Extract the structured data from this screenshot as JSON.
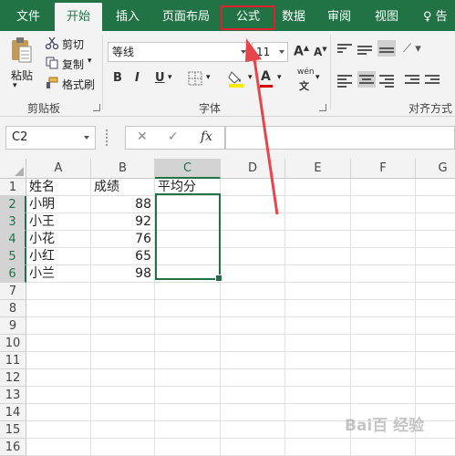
{
  "ribbon_tabs": [
    {
      "label": "文件"
    },
    {
      "label": "开始"
    },
    {
      "label": "插入"
    },
    {
      "label": "页面布局"
    },
    {
      "label": "公式"
    },
    {
      "label": "数据"
    },
    {
      "label": "审阅"
    },
    {
      "label": "视图"
    }
  ],
  "help_label": "♀ 告",
  "clipboard": {
    "paste_label": "粘贴",
    "cut_label": "剪切",
    "copy_label": "复制",
    "format_painter_label": "格式刷",
    "group_label": "剪贴板"
  },
  "font": {
    "name_value": "等线",
    "size_value": "11",
    "grow_label": "A",
    "shrink_label": "A",
    "bold_label": "B",
    "italic_label": "I",
    "underline_label": "U",
    "font_color_label": "A",
    "phonetic_label": "wén",
    "group_label": "字体"
  },
  "alignment": {
    "group_label": "对齐方式"
  },
  "formula_bar": {
    "name_box": "C2",
    "cancel_symbol": "✕",
    "enter_symbol": "✓",
    "fx_symbol": "fx",
    "content": ""
  },
  "sheet": {
    "columns": [
      "A",
      "B",
      "C",
      "D",
      "E",
      "F",
      "G"
    ],
    "rows": [
      "1",
      "2",
      "3",
      "4",
      "5",
      "6",
      "7",
      "8",
      "9",
      "10",
      "11",
      "12",
      "13",
      "14",
      "15",
      "16"
    ],
    "cells": {
      "A1": "姓名",
      "B1": "成绩",
      "C1": "平均分",
      "A2": "小明",
      "B2": "88",
      "A3": "小王",
      "B3": "92",
      "A4": "小花",
      "B4": "76",
      "A5": "小红",
      "B5": "65",
      "A6": "小兰",
      "B6": "98"
    }
  },
  "watermark_text": "Bai百 经验",
  "colors": {
    "excel_green": "#217346",
    "highlight_red": "#e0202a",
    "font_color_bar": "#d40000",
    "fill_color_bar": "#ffeb00"
  }
}
